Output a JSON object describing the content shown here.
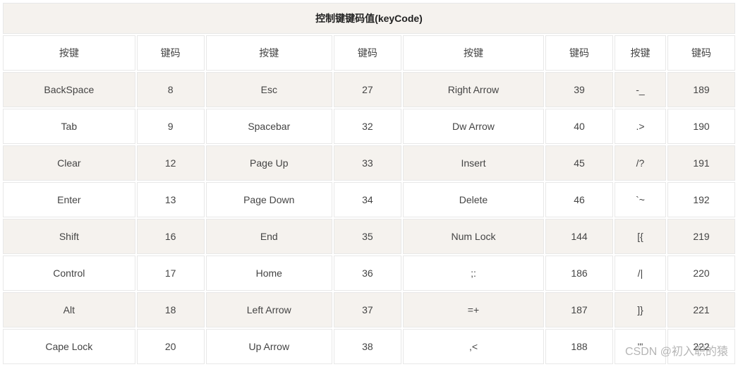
{
  "title": "控制键键码值(keyCode)",
  "headers": [
    "按键",
    "键码",
    "按键",
    "键码",
    "按键",
    "键码",
    "按键",
    "键码"
  ],
  "rows": [
    [
      "BackSpace",
      "8",
      "Esc",
      "27",
      "Right Arrow",
      "39",
      "-_",
      "189"
    ],
    [
      "Tab",
      "9",
      "Spacebar",
      "32",
      "Dw Arrow",
      "40",
      ".>",
      "190"
    ],
    [
      "Clear",
      "12",
      "Page Up",
      "33",
      "Insert",
      "45",
      "/?",
      "191"
    ],
    [
      "Enter",
      "13",
      "Page Down",
      "34",
      "Delete",
      "46",
      "`~",
      "192"
    ],
    [
      "Shift",
      "16",
      "End",
      "35",
      "Num Lock",
      "144",
      "[{",
      "219"
    ],
    [
      "Control",
      "17",
      "Home",
      "36",
      ";:",
      "186",
      "/|",
      "220"
    ],
    [
      "Alt",
      "18",
      "Left Arrow",
      "37",
      "=+",
      "187",
      "]}",
      "221"
    ],
    [
      "Cape Lock",
      "20",
      "Up Arrow",
      "38",
      ",<",
      "188",
      "'\"",
      "222"
    ]
  ],
  "watermark": "CSDN @初入职的猿",
  "chart_data": {
    "type": "table",
    "title": "控制键键码值(keyCode)",
    "columns": [
      "按键",
      "键码",
      "按键",
      "键码",
      "按键",
      "键码",
      "按键",
      "键码"
    ],
    "data": [
      [
        "BackSpace",
        8,
        "Esc",
        27,
        "Right Arrow",
        39,
        "-_",
        189
      ],
      [
        "Tab",
        9,
        "Spacebar",
        32,
        "Dw Arrow",
        40,
        ".>",
        190
      ],
      [
        "Clear",
        12,
        "Page Up",
        33,
        "Insert",
        45,
        "/?",
        191
      ],
      [
        "Enter",
        13,
        "Page Down",
        34,
        "Delete",
        46,
        "`~",
        192
      ],
      [
        "Shift",
        16,
        "End",
        35,
        "Num Lock",
        144,
        "[{",
        219
      ],
      [
        "Control",
        17,
        "Home",
        36,
        ";:",
        186,
        "/|",
        220
      ],
      [
        "Alt",
        18,
        "Left Arrow",
        37,
        "=+",
        187,
        "]}",
        221
      ],
      [
        "Cape Lock",
        20,
        "Up Arrow",
        38,
        ",<",
        188,
        "'\"",
        222
      ]
    ]
  }
}
